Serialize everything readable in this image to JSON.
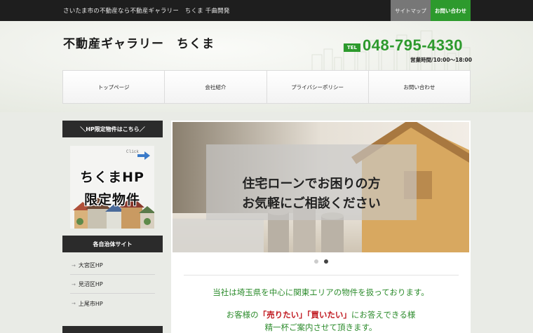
{
  "topbar": {
    "tagline": "さいたま市の不動産なら不動産ギャラリー　ちくま 千曲開発",
    "sitemap_label": "サイトマップ",
    "contact_label": "お問い合わせ"
  },
  "header": {
    "site_title": "不動産ギャラリー　ちくま",
    "tel_badge": "TEL",
    "tel_number": "048-795-4330",
    "hours": "営業時間/10:00～18:00"
  },
  "nav": {
    "items": [
      {
        "label": "トップページ"
      },
      {
        "label": "会社紹介"
      },
      {
        "label": "プライバシーポリシー"
      },
      {
        "label": "お問い合わせ"
      }
    ]
  },
  "sidebar": {
    "hp_limited_heading": "＼HP限定物件はこちら／",
    "banner": {
      "click_text": "Click",
      "line1": "ちくまHP",
      "line2": "限定物件"
    },
    "municipal_heading": "各自治体サイト",
    "links": [
      {
        "label": "大宮区HP"
      },
      {
        "label": "見沼区HP"
      },
      {
        "label": "上尾市HP"
      }
    ]
  },
  "slider": {
    "caption_line1": "住宅ローンでお困りの方",
    "caption_line2": "お気軽にご相談ください",
    "current_slide": 2,
    "total_slides": 2
  },
  "intro": {
    "line1": "当社は埼玉県を中心に関東エリアの物件を扱っております。",
    "line2_pre": "お客様の",
    "line2_sell": "「売りたい」",
    "line2_buy": "「買いたい」",
    "line2_post": "にお答えできる様",
    "line3": "精一杯ご案内させて頂きます。"
  },
  "colors": {
    "accent_green": "#2d9a2d",
    "dark": "#1e1e1e",
    "highlight_red": "#c0181f"
  },
  "icons": {
    "sidebar_link_arrow": "arrow-right-icon"
  }
}
